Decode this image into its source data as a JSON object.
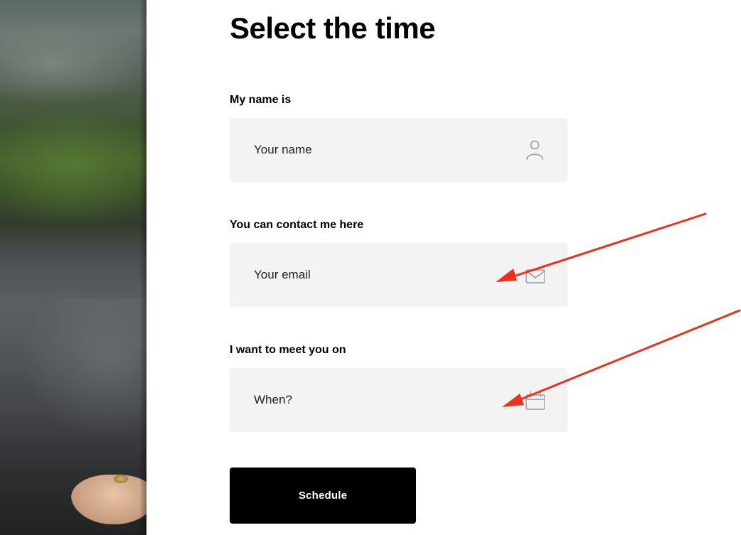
{
  "page": {
    "title": "Select the time"
  },
  "form": {
    "name": {
      "label": "My name is",
      "placeholder": "Your name",
      "icon": "user-icon"
    },
    "contact": {
      "label": "You can contact me here",
      "placeholder": "Your email",
      "icon": "mail-icon"
    },
    "meeting": {
      "label": "I want to meet you on",
      "placeholder": "When?",
      "icon": "calendar-icon"
    },
    "submit_label": "Schedule"
  },
  "colors": {
    "field_background": "#f3f3f3",
    "button_background": "#000000",
    "button_text": "#ffffff",
    "icon_stroke": "#9a9a9a",
    "annotation_arrow": "#e8321f"
  }
}
